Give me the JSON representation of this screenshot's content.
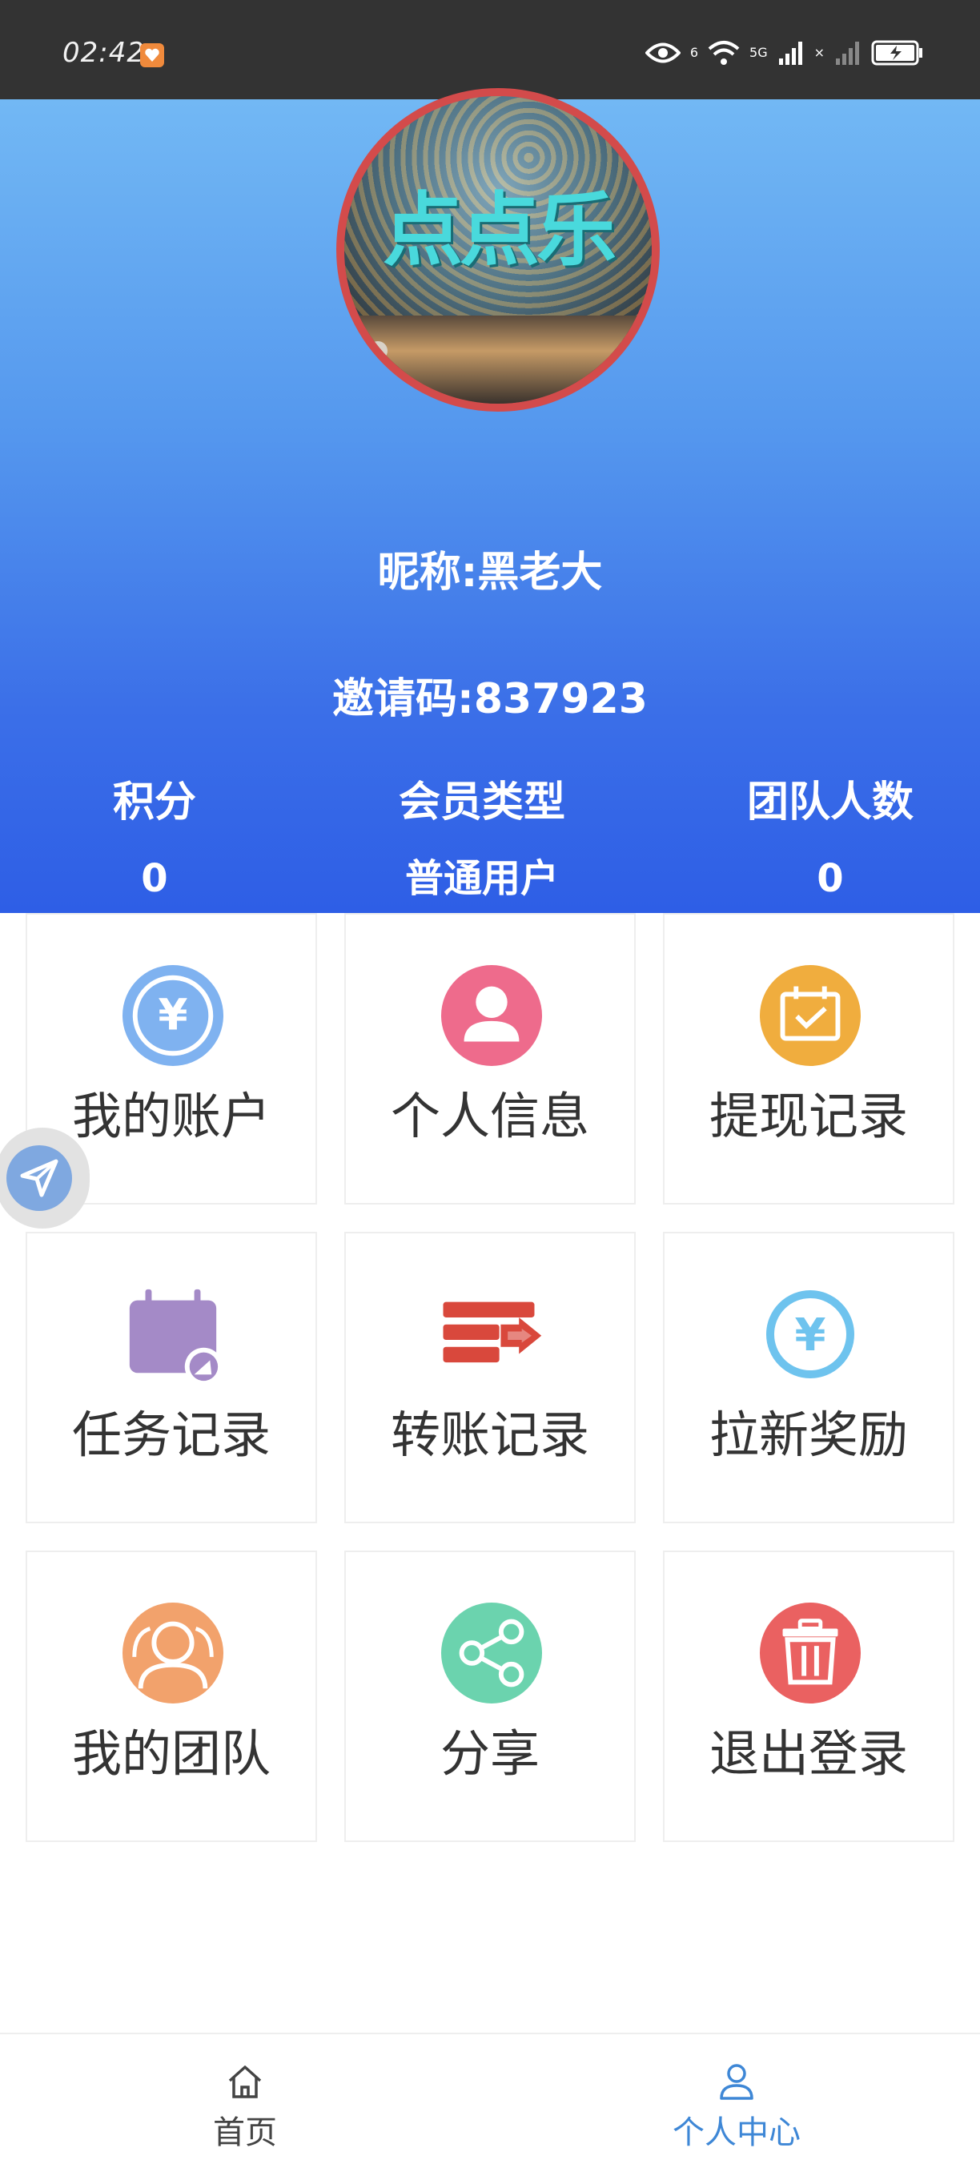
{
  "status_bar": {
    "time": "02:42",
    "signal_labels": [
      "6",
      "5G",
      "×"
    ]
  },
  "profile": {
    "avatar_text": "点点乐",
    "nickname": "昵称:黑老大",
    "invite_code": "邀请码:837923"
  },
  "stats": [
    {
      "label": "积分",
      "value": "0"
    },
    {
      "label": "会员类型",
      "value": "普通用户"
    },
    {
      "label": "团队人数",
      "value": "0"
    }
  ],
  "menu": [
    {
      "label": "我的账户",
      "icon": "yuan-circle-icon",
      "color": "#7fb2f0"
    },
    {
      "label": "个人信息",
      "icon": "person-icon",
      "color": "#ee6b8c"
    },
    {
      "label": "提现记录",
      "icon": "calendar-check-icon",
      "color": "#f0ad3e"
    },
    {
      "label": "任务记录",
      "icon": "task-calendar-icon",
      "color": "#a48ac7"
    },
    {
      "label": "转账记录",
      "icon": "transfer-icon",
      "color": "#d9483c"
    },
    {
      "label": "拉新奖励",
      "icon": "yuan-outline-icon",
      "color": "#6ec3ee"
    },
    {
      "label": "我的团队",
      "icon": "team-icon",
      "color": "#f2a26c"
    },
    {
      "label": "分享",
      "icon": "share-icon",
      "color": "#6bd3ae"
    },
    {
      "label": "退出登录",
      "icon": "logout-icon",
      "color": "#ea6161"
    }
  ],
  "tabbar": {
    "items": [
      {
        "label": "首页",
        "icon": "home-icon"
      },
      {
        "label": "个人中心",
        "icon": "user-icon",
        "active": true
      }
    ],
    "active_color": "#3e87d6",
    "inactive_color": "#444444"
  }
}
